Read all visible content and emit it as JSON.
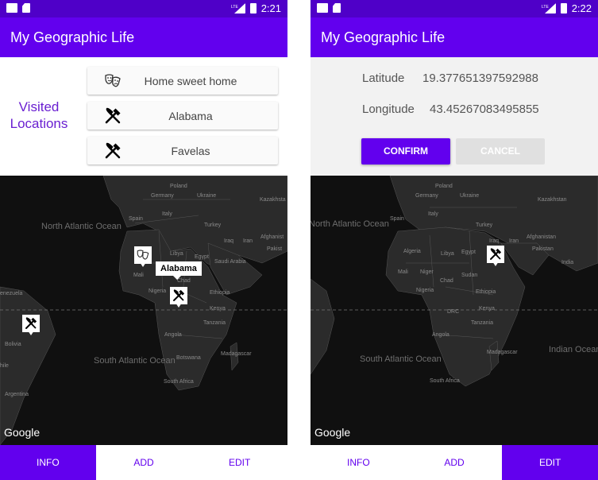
{
  "left": {
    "status": {
      "time": "2:21"
    },
    "app_title": "My Geographic Life",
    "visited_label": "Visited Locations",
    "locations": [
      {
        "label": "Home sweet home",
        "icon": "theater-masks-icon"
      },
      {
        "label": "Alabama",
        "icon": "fork-knife-icon"
      },
      {
        "label": "Favelas",
        "icon": "fork-knife-icon"
      }
    ],
    "map": {
      "info_window": "Alabama",
      "labels": {
        "poland": "Poland",
        "germany": "Germany",
        "ukraine": "Ukraine",
        "kazakhstan": "Kazakhsta",
        "spain": "Spain",
        "italy": "Italy",
        "turkey": "Turkey",
        "iraq": "Iraq",
        "iran": "Iran",
        "afghanistan": "Afghanist",
        "pakistan": "Pakist",
        "libya": "Libya",
        "egypt": "Egypt",
        "saudi": "Saudi Arabia",
        "mali": "Mali",
        "chad": "Chad",
        "nigeria": "Nigeria",
        "ethiopia": "Ethiopia",
        "kenya": "Kenya",
        "tanzania": "Tanzania",
        "angola": "Angola",
        "madagascar": "Madagascar",
        "botswana": "Botswana",
        "south_africa": "South Africa",
        "venezuela": "enezuela",
        "bolivia": "Bolivia",
        "argentina": "Argentina",
        "chile": "hile"
      },
      "oceans": {
        "north_atlantic": "North Atlantic Ocean",
        "south_atlantic": "South Atlantic Ocean"
      },
      "google": "Google"
    },
    "nav": [
      "INFO",
      "ADD",
      "EDIT"
    ]
  },
  "right": {
    "status": {
      "time": "2:22"
    },
    "app_title": "My Geographic Life",
    "latitude_label": "Latitude",
    "latitude_value": "19.377651397592988",
    "longitude_label": "Longitude",
    "longitude_value": "43.45267083495855",
    "confirm": "CONFIRM",
    "cancel": "CANCEL",
    "map": {
      "labels": {
        "poland": "Poland",
        "germany": "Germany",
        "ukraine": "Ukraine",
        "kazakhstan": "Kazakhstan",
        "italy": "Italy",
        "turkey": "Turkey",
        "iraq": "Iraq",
        "iran": "Iran",
        "spain": "Spain",
        "afghanistan": "Afghanistan",
        "pakistan": "Pakistan",
        "india": "India",
        "algeria": "Algeria",
        "libya": "Libya",
        "egypt": "Egypt",
        "mali": "Mali",
        "niger": "Niger",
        "chad": "Chad",
        "sudan": "Sudan",
        "nigeria": "Nigeria",
        "ethiopia": "Ethiopia",
        "drc": "DRC",
        "kenya": "Kenya",
        "tanzania": "Tanzania",
        "angola": "Angola",
        "madagascar": "Madagascar",
        "south_africa": "South Africa"
      },
      "oceans": {
        "north_atlantic": "North Atlantic Ocean",
        "south_atlantic": "South Atlantic Ocean",
        "indian": "Indian Ocean"
      },
      "google": "Google"
    },
    "nav": [
      "INFO",
      "ADD",
      "EDIT"
    ]
  },
  "colors": {
    "statusbar": "#4f00c8",
    "appbar": "#6200ee",
    "map_land": "#2b2b2b",
    "map_water": "#0e0e0e"
  }
}
